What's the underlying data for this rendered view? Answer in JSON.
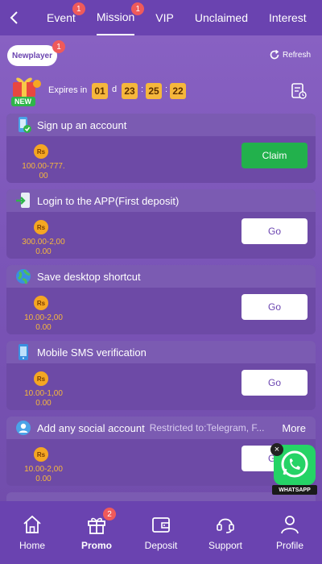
{
  "header": {
    "tabs": [
      {
        "label": "Event",
        "badge": "1"
      },
      {
        "label": "Mission",
        "badge": "1",
        "active": true
      },
      {
        "label": "VIP"
      },
      {
        "label": "Unclaimed"
      },
      {
        "label": "Interest"
      }
    ]
  },
  "subheader": {
    "chip_label": "Newplayer",
    "chip_badge": "1",
    "refresh_label": "Refresh"
  },
  "expires": {
    "label": "Expires in",
    "days": "01",
    "day_unit": "d",
    "hours": "23",
    "minutes": "25",
    "seconds": "22",
    "gift_badge": "NEW"
  },
  "tasks": [
    {
      "title": "Sign up an account",
      "currency": "Rs",
      "amount": "100.00-777.\n00",
      "button": "Claim",
      "icon": "phone-check-icon"
    },
    {
      "title": "Login to the APP(First deposit)",
      "currency": "Rs",
      "amount": "300.00-2,00\n0.00",
      "button": "Go",
      "icon": "login-app-icon"
    },
    {
      "title": "Save desktop shortcut",
      "currency": "Rs",
      "amount": "10.00-2,00\n0.00",
      "button": "Go",
      "icon": "globe-icon"
    },
    {
      "title": "Mobile SMS verification",
      "currency": "Rs",
      "amount": "10.00-1,00\n0.00",
      "button": "Go",
      "icon": "mobile-sms-icon"
    },
    {
      "title": "Add any social account",
      "restriction": "Restricted to:Telegram, F...",
      "more": "More",
      "currency": "Rs",
      "amount": "10.00-2,00\n0.00",
      "button": "Go",
      "icon": "social-account-icon"
    }
  ],
  "whatsapp": {
    "label": "WHATSAPP"
  },
  "bottom_nav": [
    {
      "label": "Home",
      "icon": "home-icon"
    },
    {
      "label": "Promo",
      "icon": "gift-icon",
      "badge": "2",
      "active": true
    },
    {
      "label": "Deposit",
      "icon": "wallet-icon"
    },
    {
      "label": "Support",
      "icon": "headset-icon"
    },
    {
      "label": "Profile",
      "icon": "user-icon"
    }
  ],
  "colors": {
    "nav_bg": "#6a43b0",
    "accent_gold": "#f6b73c",
    "claim_green": "#22b14c",
    "badge_red": "#ef5a5a"
  }
}
